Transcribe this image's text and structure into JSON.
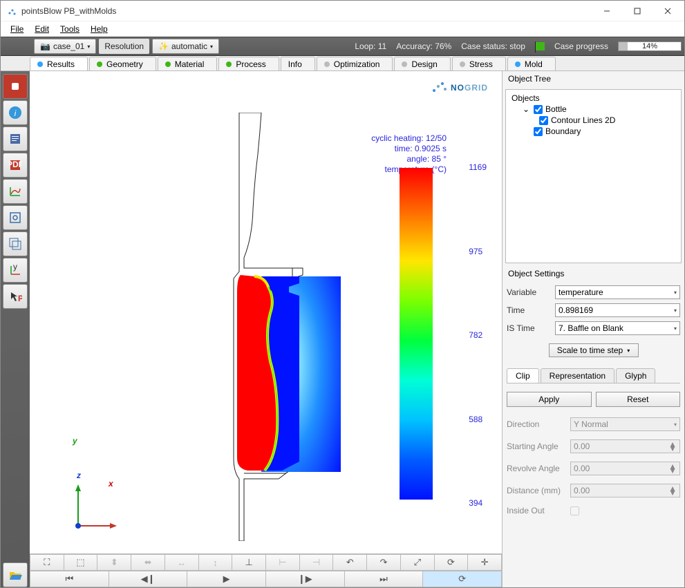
{
  "window": {
    "title": "pointsBlow PB_withMolds"
  },
  "menu": {
    "file": "File",
    "edit": "Edit",
    "tools": "Tools",
    "help": "Help"
  },
  "toolbar": {
    "case_label": "case_01",
    "resolution": "Resolution",
    "automatic": "automatic",
    "loop": "Loop: 11",
    "accuracy": "Accuracy: 76%",
    "status": "Case status: stop",
    "progress_label": "Case progress",
    "progress_pct": "14%"
  },
  "tabs": [
    {
      "label": "Results",
      "color": "blue",
      "active": true
    },
    {
      "label": "Geometry",
      "color": "green"
    },
    {
      "label": "Material",
      "color": "green"
    },
    {
      "label": "Process",
      "color": "green"
    },
    {
      "label": "Info",
      "color": "none"
    },
    {
      "label": "Optimization",
      "color": "grey"
    },
    {
      "label": "Design",
      "color": "grey"
    },
    {
      "label": "Stress",
      "color": "grey"
    },
    {
      "label": "Mold",
      "color": "blue"
    }
  ],
  "logo": {
    "no": "NO",
    "grid": "GRID"
  },
  "caption": {
    "l1": "cyclic heating: 12/50",
    "l2": "time: 0.9025 s",
    "l3": "angle: 85 °",
    "l4": "temperature (°C)"
  },
  "colorbar": {
    "v0": "1169",
    "v1": "975",
    "v2": "782",
    "v3": "588",
    "v4": "394"
  },
  "axis": {
    "x": "x",
    "y": "y",
    "z": "z"
  },
  "tree": {
    "title": "Object Tree",
    "root": "Objects",
    "bottle": "Bottle",
    "contour": "Contour Lines 2D",
    "boundary": "Boundary"
  },
  "settings": {
    "title": "Object Settings",
    "variable_l": "Variable",
    "variable_v": "temperature",
    "time_l": "Time",
    "time_v": "0.898169",
    "istime_l": "IS Time",
    "istime_v": "7. Baffle on Blank",
    "scale": "Scale to time step",
    "subtabs": {
      "clip": "Clip",
      "rep": "Representation",
      "glyph": "Glyph"
    },
    "apply": "Apply",
    "reset": "Reset",
    "direction_l": "Direction",
    "direction_v": "Y Normal",
    "startang_l": "Starting Angle",
    "startang_v": "0.00",
    "revang_l": "Revolve Angle",
    "revang_v": "0.00",
    "dist_l": "Distance (mm)",
    "dist_v": "0.00",
    "inside_l": "Inside Out"
  },
  "viewtools": [
    "⛶",
    "⛶",
    "⬍",
    "⬌",
    "↕",
    "↔",
    "↗",
    "⟲",
    "⟳",
    "⤢",
    "↻",
    "↺",
    "⇅",
    "⟳",
    "↘"
  ],
  "transport": [
    "⏮",
    "◀",
    "▶",
    "⏵",
    "⏭",
    "⟳"
  ],
  "chart_data": {
    "type": "heatmap",
    "title": "temperature (°C)",
    "series": [
      {
        "name": "temperature",
        "values": [
          1169,
          975,
          782,
          588,
          394
        ]
      }
    ],
    "ylim": [
      394,
      1169
    ],
    "annotations": {
      "cyclic_heating": "12/50",
      "time_s": 0.9025,
      "angle_deg": 85
    }
  }
}
